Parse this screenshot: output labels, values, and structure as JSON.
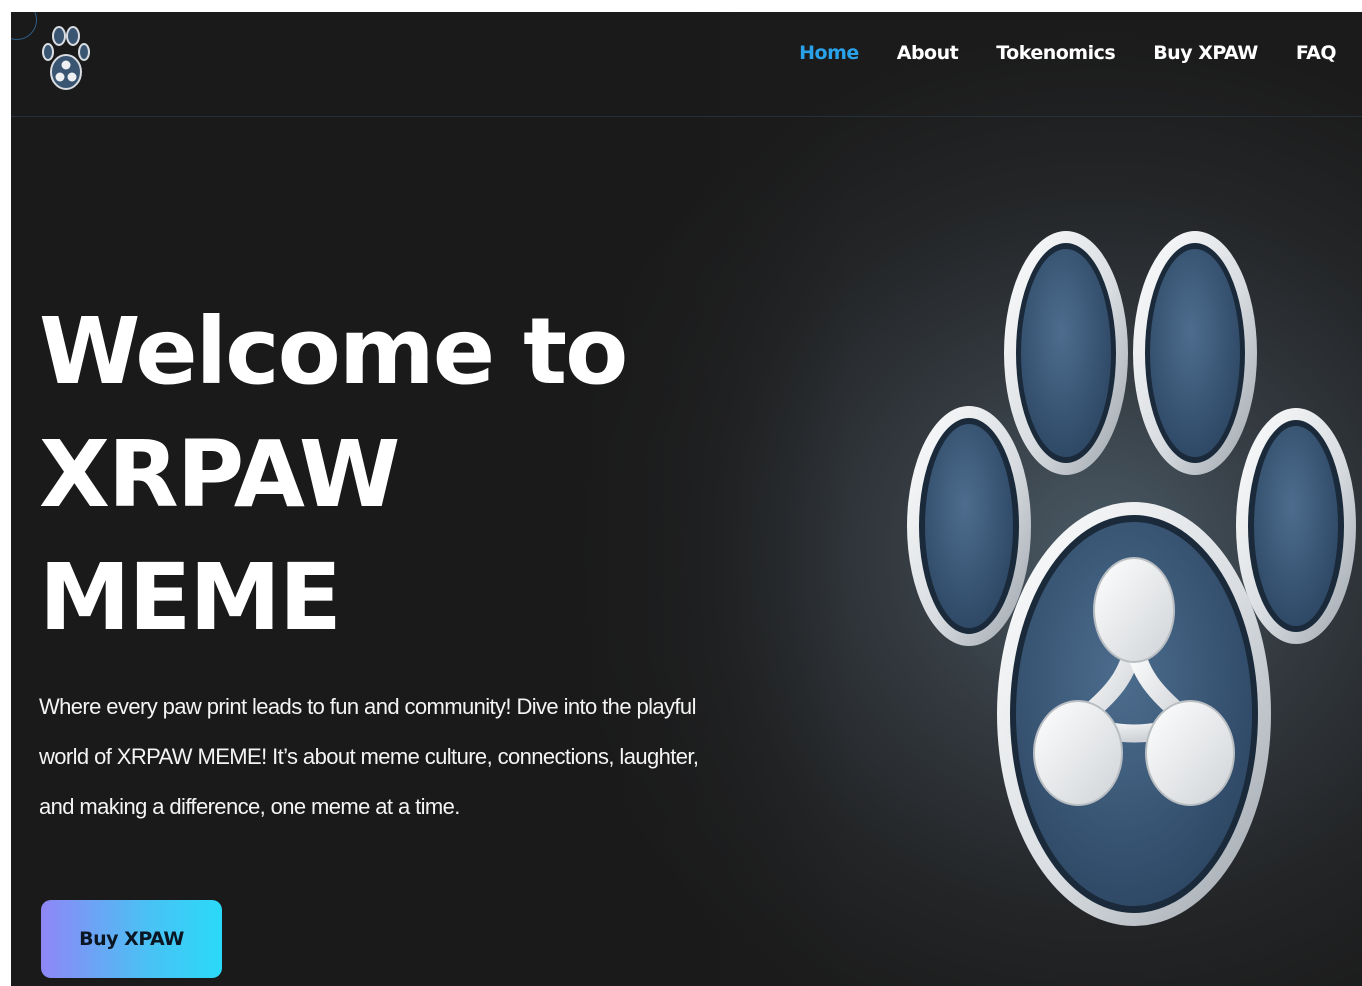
{
  "nav": {
    "logo_icon": "paw-logo-icon",
    "links": [
      {
        "label": "Home",
        "active": true
      },
      {
        "label": "About",
        "active": false
      },
      {
        "label": "Tokenomics",
        "active": false
      },
      {
        "label": "Buy XPAW",
        "active": false
      },
      {
        "label": "FAQ",
        "active": false
      }
    ]
  },
  "hero": {
    "title_lines": [
      "Welcome to",
      "XRPAW",
      "MEME"
    ],
    "description": "Where every paw print leads to fun and community! Dive into the playful world of XRPAW MEME! It’s about meme culture, connections, laughter, and making a difference, one meme at a time.",
    "cta_label": "Buy XPAW",
    "illustration_icon": "paw-xrp-illustration"
  },
  "colors": {
    "background": "#1a1a1a",
    "active_link": "#2aa2ea",
    "text": "#ffffff",
    "paw_blue": "#3c5c7c",
    "button_gradient_start": "#8f86f6",
    "button_gradient_end": "#2ad9f8"
  }
}
